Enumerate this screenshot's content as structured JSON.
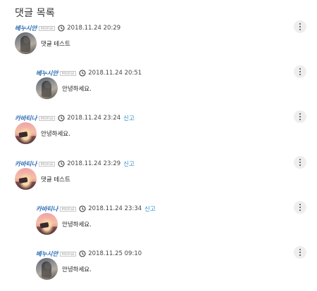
{
  "section_title": "댓글 목록",
  "profile_tag": "PROFILE",
  "report_label": "신고",
  "comments": [
    {
      "author": "베누시안",
      "timestamp": "2018.11.24 20:29",
      "text": "댓글 테스트",
      "avatar": "profile-photo-person",
      "reply": false,
      "report": false
    },
    {
      "author": "베누시안",
      "timestamp": "2018.11.24 20:51",
      "text": "안녕하세요.",
      "avatar": "profile-photo-person",
      "reply": true,
      "report": false
    },
    {
      "author": "카바티나",
      "timestamp": "2018.11.24 23:24",
      "text": "안녕하세요.",
      "avatar": "profile-photo-sunset",
      "reply": false,
      "report": true
    },
    {
      "author": "카바티나",
      "timestamp": "2018.11.24 23:29",
      "text": "댓글 테스트",
      "avatar": "profile-photo-sunset",
      "reply": false,
      "report": true
    },
    {
      "author": "카바티나",
      "timestamp": "2018.11.24 23:34",
      "text": "안녕하세요.",
      "avatar": "profile-photo-sunset",
      "reply": true,
      "report": true
    },
    {
      "author": "베누시안",
      "timestamp": "2018.11.25 09:10",
      "text": "안녕하세요.",
      "avatar": "profile-photo-person",
      "reply": true,
      "report": false
    }
  ],
  "icons": {
    "time": "clock-icon",
    "menu": "more-vertical-icon"
  },
  "colors": {
    "author": "#2f6fb5",
    "report": "#2f8fd0",
    "menu_bg": "#eeeeee"
  }
}
